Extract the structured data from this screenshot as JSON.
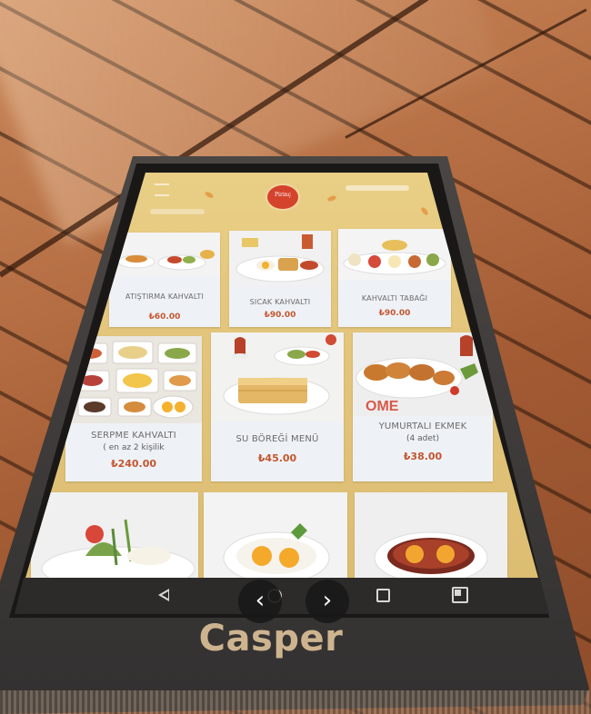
{
  "brand": "Casper",
  "screen": {
    "logo_text": "Pirinç"
  },
  "menu_items": [
    {
      "name": "ATIŞTIRMA KAHVALTI",
      "sub": "",
      "price": "₺60.00"
    },
    {
      "name": "SICAK KAHVALTI",
      "sub": "",
      "price": "₺90.00"
    },
    {
      "name": "KAHVALTI TABAĞI",
      "sub": "",
      "price": "₺90.00"
    },
    {
      "name": "SERPME KAHVALTI",
      "sub": "( en az 2 kişilik",
      "price": "₺240.00"
    },
    {
      "name": "SU BÖREĞİ MENÜ",
      "sub": "",
      "price": "₺45.00"
    },
    {
      "name": "YUMURTALI EKMEK",
      "sub": "(4 adet)",
      "price": "₺38.00"
    }
  ],
  "viewer": {
    "prev_label": "‹",
    "next_label": "›"
  },
  "colors": {
    "screen_bg": "#e3c57b",
    "price": "#c4562f",
    "card_bg": "#eef2f7",
    "logo_red": "#d4432c"
  }
}
